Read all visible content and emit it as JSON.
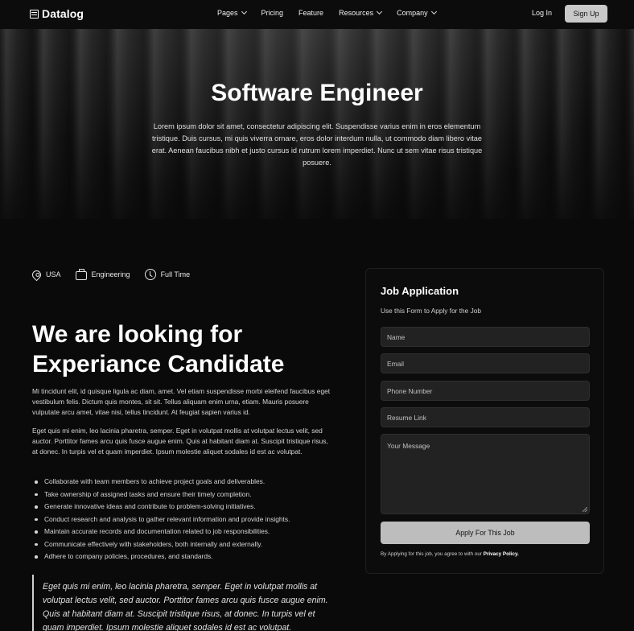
{
  "nav": {
    "logo": "Datalog",
    "menu": [
      {
        "label": "Pages",
        "dropdown": true
      },
      {
        "label": "Pricing",
        "dropdown": false
      },
      {
        "label": "Feature",
        "dropdown": false
      },
      {
        "label": "Resources",
        "dropdown": true
      },
      {
        "label": "Company",
        "dropdown": true
      }
    ],
    "login": "Log In",
    "signup": "Sign Up"
  },
  "hero": {
    "title": "Software Engineer",
    "description": "Lorem ipsum dolor sit amet, consectetur adipiscing elit. Suspendisse varius enim in eros elementum tristique. Duis cursus, mi quis viverra ornare, eros dolor interdum nulla, ut commodo diam libero vitae erat. Aenean faucibus nibh et justo cursus id rutrum lorem imperdiet. Nunc ut sem vitae risus tristique posuere."
  },
  "meta": {
    "location": "USA",
    "department": "Engineering",
    "type": "Full Time"
  },
  "content": {
    "headline": "We are looking for Experiance Candidate",
    "paragraph1": "Mi tincidunt elit, id quisque ligula ac diam, amet. Vel etiam suspendisse morbi eleifend faucibus eget vestibulum felis. Dictum quis montes, sit sit. Tellus aliquam enim urna, etiam. Mauris posuere vulputate arcu amet, vitae nisi, tellus tincidunt. At feugiat sapien varius id.",
    "paragraph2": "Eget quis mi enim, leo lacinia pharetra, semper. Eget in volutpat mollis at volutpat lectus velit, sed auctor. Porttitor fames arcu quis fusce augue enim. Quis at habitant diam at. Suscipit tristique risus, at donec. In turpis vel et quam imperdiet. Ipsum molestie aliquet sodales id est ac volutpat.",
    "bullets": [
      "Collaborate with team members to achieve project goals and deliverables.",
      "Take ownership of assigned tasks and ensure their timely completion.",
      "Generate innovative ideas and contribute to problem-solving initiatives.",
      "Conduct research and analysis to gather relevant information and provide insights.",
      "Maintain accurate records and documentation related to job responsibilities.",
      "Communicate effectively with stakeholders, both internally and externally.",
      "Adhere to company policies, procedures, and standards."
    ],
    "quote": "Eget quis mi enim, leo lacinia pharetra, semper. Eget in volutpat mollis at volutpat lectus velit, sed auctor. Porttitor fames arcu quis fusce augue enim. Quis at habitant diam at. Suscipit tristique risus, at donec. In turpis vel et quam imperdiet. Ipsum molestie aliquet sodales id est ac volutpat."
  },
  "form": {
    "title": "Job Application",
    "subtitle": "Use this Form to Apply for the Job",
    "name_placeholder": "Name",
    "email_placeholder": "Email",
    "phone_placeholder": "Phone Number",
    "resume_placeholder": "Resume Link",
    "message_placeholder": "Your Message",
    "submit": "Apply For This Job",
    "terms_prefix": "By Applying for this job, you agree to with our",
    "terms_link": "Privacy Policy."
  }
}
